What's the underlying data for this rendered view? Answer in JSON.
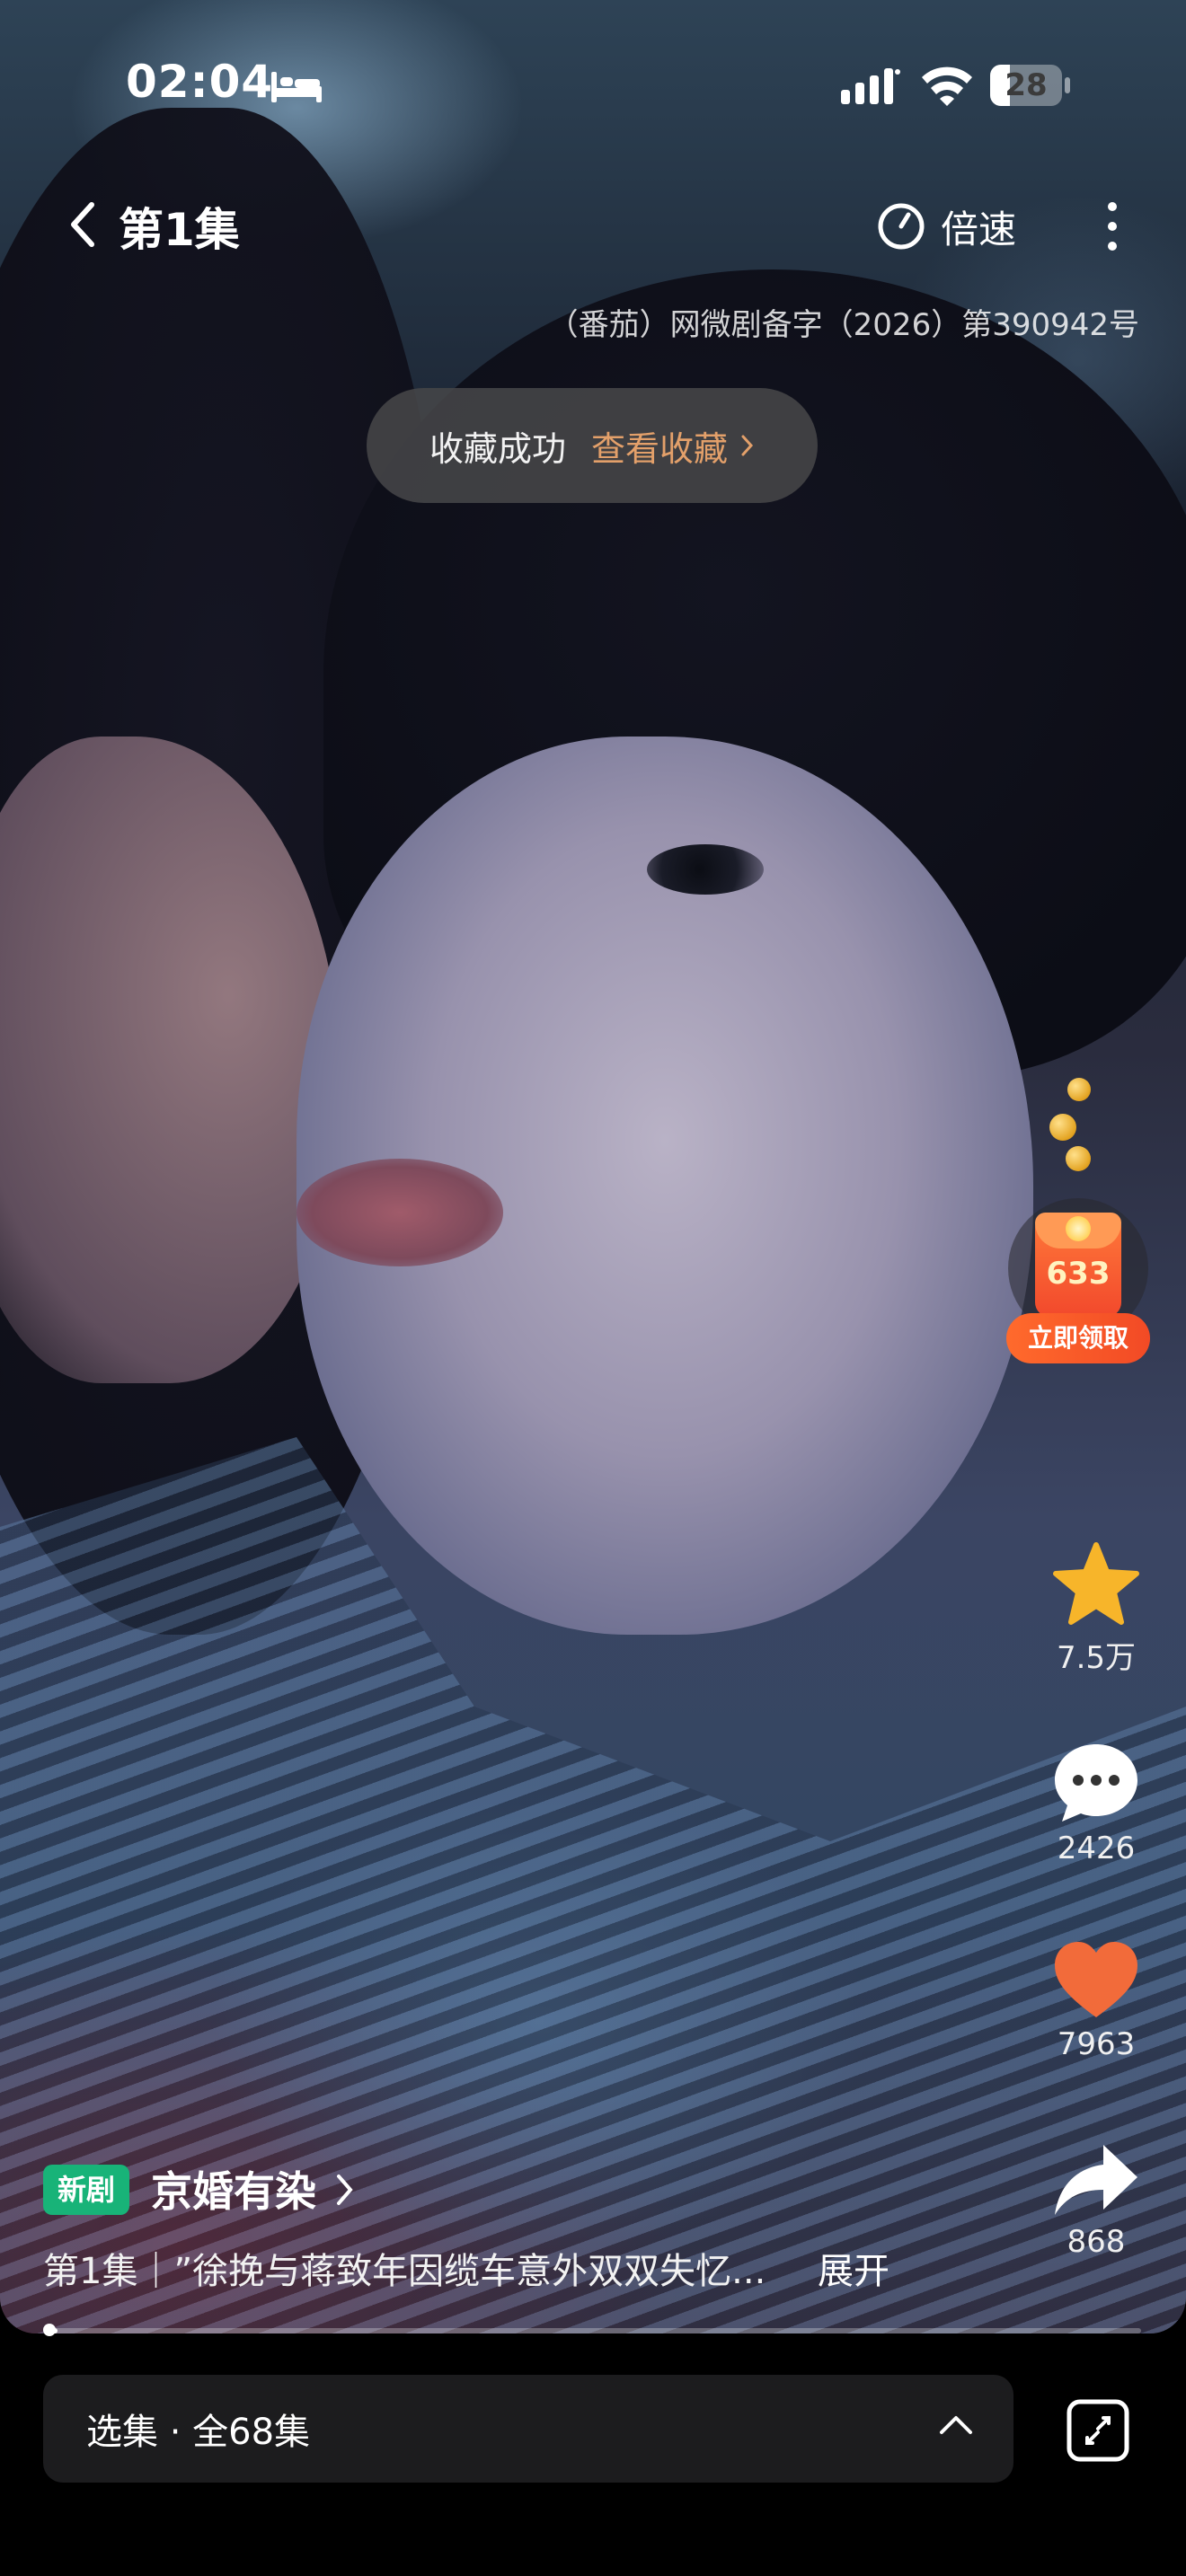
{
  "status_bar": {
    "time": "02:04",
    "battery": "28",
    "battery_level": 0.28,
    "icons": [
      "bed-icon",
      "cellular-signal-icon",
      "wifi-icon",
      "battery-icon"
    ]
  },
  "nav": {
    "episode_title": "第1集",
    "speed_label": "倍速",
    "license_text": "（番茄）网微剧备字（2026）第390942号"
  },
  "toast": {
    "message": "收藏成功",
    "link": "查看收藏"
  },
  "rewards": {
    "packet_number": "633",
    "claim_label": "立即领取"
  },
  "actions": {
    "favorite_count": "7.5万",
    "comment_count": "2426",
    "like_count": "7963",
    "share_count": "868"
  },
  "info": {
    "badge": "新剧",
    "drama_title": "京婚有染",
    "synopsis": "第1集｜”徐挽与蒋致年因缆车意外双双失忆...",
    "expand_label": "展开"
  },
  "playback": {
    "progress": 0.01
  },
  "bottom_bar": {
    "selector_label": "选集 · 全68集"
  },
  "colors": {
    "badge_green": "#18b378",
    "toast_link": "#e3a06a",
    "favorite_star": "#f7b52a",
    "like_heart": "#f26b3a",
    "claim_orange": "#f24a25"
  }
}
